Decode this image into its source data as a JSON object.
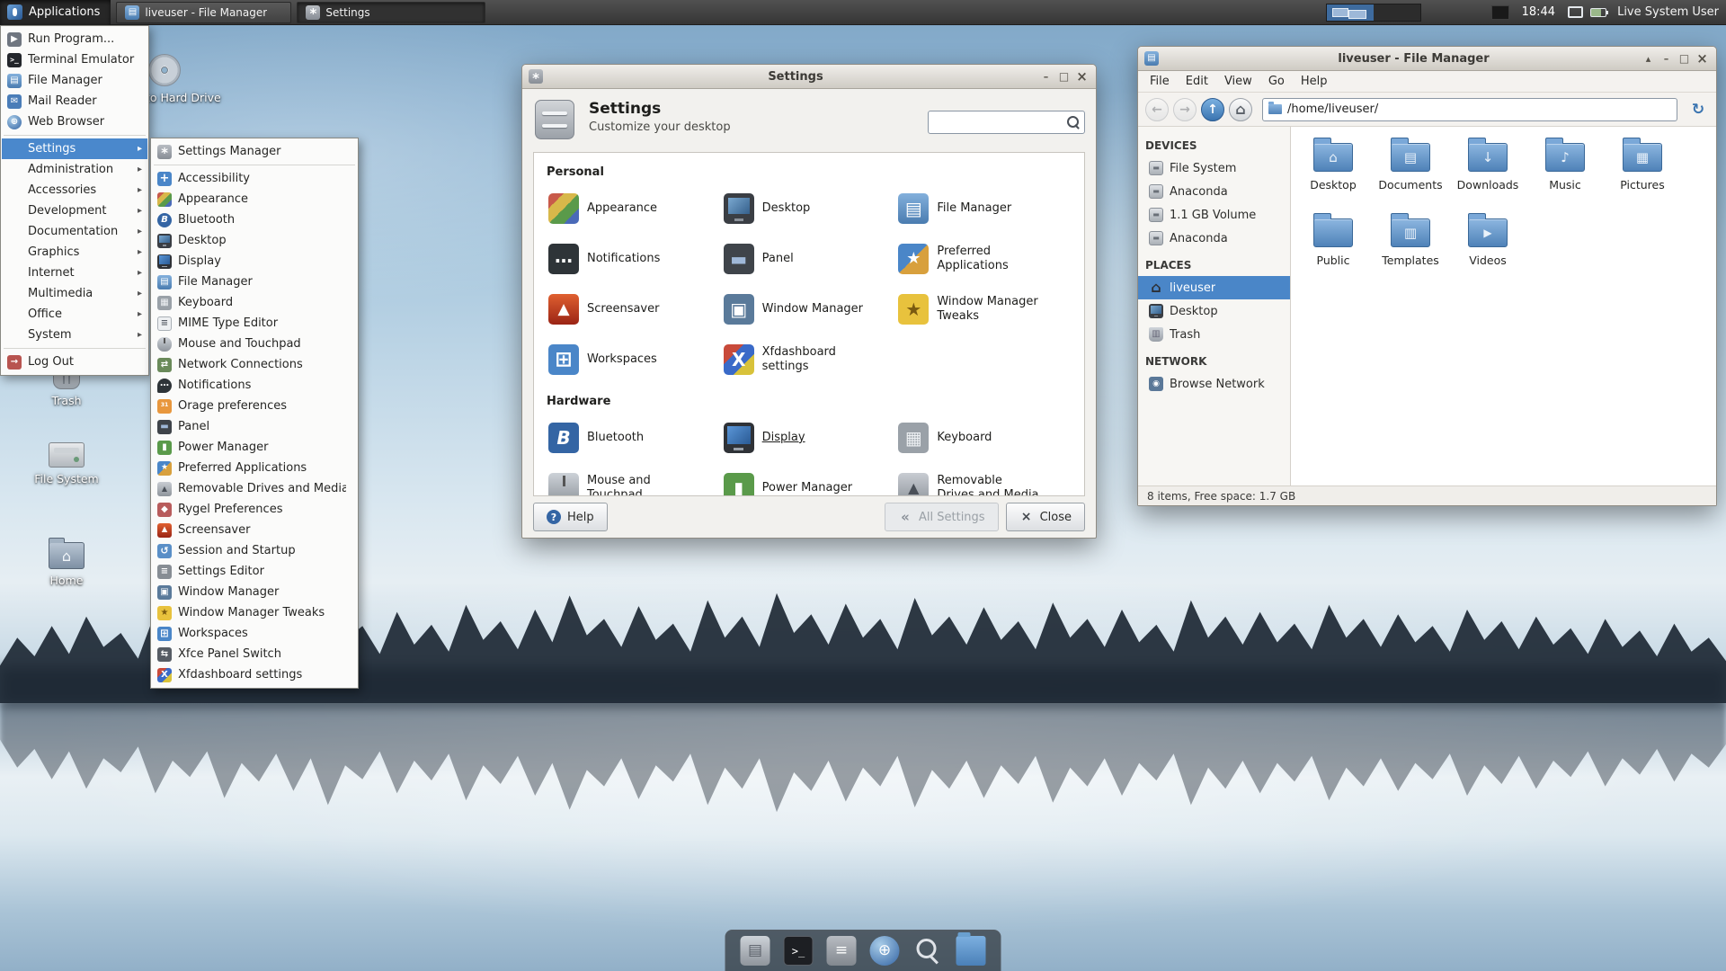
{
  "taskbar": {
    "applications": "Applications",
    "windows": [
      {
        "label": "liveuser - File Manager"
      },
      {
        "label": "Settings"
      }
    ],
    "clock": "18:44",
    "user": "Live System User"
  },
  "applications_menu": {
    "items": [
      {
        "label": "Run Program...",
        "icon": "ic-run"
      },
      {
        "label": "Terminal Emulator",
        "icon": "ic-terminal"
      },
      {
        "label": "File Manager",
        "icon": "ic-filemanager"
      },
      {
        "label": "Mail Reader",
        "icon": "ic-mail"
      },
      {
        "label": "Web Browser",
        "icon": "ic-browser"
      },
      {
        "cls": "separator"
      },
      {
        "label": "Settings",
        "cls": "highlighted",
        "arrow": "▸"
      },
      {
        "label": "Administration",
        "arrow": "▸"
      },
      {
        "label": "Accessories",
        "arrow": "▸"
      },
      {
        "label": "Development",
        "arrow": "▸"
      },
      {
        "label": "Documentation",
        "arrow": "▸"
      },
      {
        "label": "Graphics",
        "arrow": "▸"
      },
      {
        "label": "Internet",
        "arrow": "▸"
      },
      {
        "label": "Multimedia",
        "arrow": "▸"
      },
      {
        "label": "Office",
        "arrow": "▸"
      },
      {
        "label": "System",
        "arrow": "▸"
      },
      {
        "cls": "separator"
      },
      {
        "label": "Log Out",
        "icon": "ic-logout"
      }
    ]
  },
  "settings_submenu": {
    "items": [
      {
        "label": "Settings Manager",
        "icon": "ic-gear"
      },
      {
        "cls": "separator"
      },
      {
        "label": "Accessibility",
        "icon": "ic-access"
      },
      {
        "label": "Appearance",
        "icon": "ic-appearance"
      },
      {
        "label": "Bluetooth",
        "icon": "ic-bluetooth"
      },
      {
        "label": "Desktop",
        "icon": "ic-desktopmon"
      },
      {
        "label": "Display",
        "icon": "ic-display"
      },
      {
        "label": "File Manager",
        "icon": "ic-filemanager"
      },
      {
        "label": "Keyboard",
        "icon": "ic-keyboard"
      },
      {
        "label": "MIME Type Editor",
        "icon": "ic-mime"
      },
      {
        "label": "Mouse and Touchpad",
        "icon": "ic-mouse"
      },
      {
        "label": "Network Connections",
        "icon": "ic-network"
      },
      {
        "label": "Notifications",
        "icon": "ic-notify"
      },
      {
        "label": "Orage preferences",
        "icon": "ic-orage"
      },
      {
        "label": "Panel",
        "icon": "ic-panel"
      },
      {
        "label": "Power Manager",
        "icon": "ic-power"
      },
      {
        "label": "Preferred Applications",
        "icon": "ic-preferred"
      },
      {
        "label": "Removable Drives and Media",
        "icon": "ic-removable"
      },
      {
        "label": "Rygel Preferences",
        "icon": "ic-rygel"
      },
      {
        "label": "Screensaver",
        "icon": "ic-screensaver"
      },
      {
        "label": "Session and Startup",
        "icon": "ic-session"
      },
      {
        "label": "Settings Editor",
        "icon": "ic-editor"
      },
      {
        "label": "Window Manager",
        "icon": "ic-wm"
      },
      {
        "label": "Window Manager Tweaks",
        "icon": "ic-wmtweaks"
      },
      {
        "label": "Workspaces",
        "icon": "ic-workspaces"
      },
      {
        "label": "Xfce Panel Switch",
        "icon": "ic-panelswitch"
      },
      {
        "label": "Xfdashboard settings",
        "icon": "ic-xfdash"
      }
    ]
  },
  "settings_window": {
    "title": "Settings",
    "header_title": "Settings",
    "header_subtitle": "Customize your desktop",
    "search_value": "",
    "personal_title": "Personal",
    "personal_tiles": [
      {
        "label": "Appearance",
        "icon": "ic-appearance"
      },
      {
        "label": "Desktop",
        "icon": "ic-desktopmon"
      },
      {
        "label": "File Manager",
        "icon": "ic-filemanager"
      },
      {
        "label": "Notifications",
        "icon": "ic-notify"
      },
      {
        "label": "Panel",
        "icon": "ic-panel"
      },
      {
        "label": "Preferred Applications",
        "icon": "ic-preferred"
      },
      {
        "label": "Screensaver",
        "icon": "ic-screensaver"
      },
      {
        "label": "Window Manager",
        "icon": "ic-wm"
      },
      {
        "label": "Window Manager Tweaks",
        "icon": "ic-wmtweaks"
      },
      {
        "label": "Workspaces",
        "icon": "ic-workspaces"
      },
      {
        "label": "Xfdashboard settings",
        "icon": "ic-xfdash"
      }
    ],
    "hardware_title": "Hardware",
    "hardware_tiles": [
      {
        "label": "Bluetooth",
        "icon": "ic-bluetooth"
      },
      {
        "label": "Display",
        "icon": "ic-display",
        "cls": "focused"
      },
      {
        "label": "Keyboard",
        "icon": "ic-keyboard"
      },
      {
        "label": "Mouse and Touchpad",
        "icon": "ic-mouse"
      },
      {
        "label": "Power Manager",
        "icon": "ic-power"
      },
      {
        "label": "Removable Drives and Media",
        "icon": "ic-removable"
      }
    ],
    "buttons": {
      "help": "Help",
      "all_settings": "All Settings",
      "close": "Close"
    }
  },
  "file_manager": {
    "title": "liveuser - File Manager",
    "menu": [
      "File",
      "Edit",
      "View",
      "Go",
      "Help"
    ],
    "path": "/home/liveuser/",
    "devices_header": "DEVICES",
    "devices": [
      {
        "label": "File System",
        "icon": "ic-harddisk"
      },
      {
        "label": "Anaconda",
        "icon": "ic-harddisk"
      },
      {
        "label": "1.1 GB Volume",
        "icon": "ic-harddisk"
      },
      {
        "label": "Anaconda",
        "icon": "ic-harddisk"
      }
    ],
    "places_header": "PLACES",
    "places": [
      {
        "label": "liveuser",
        "icon": "ic-homedir",
        "cls": "selected"
      },
      {
        "label": "Desktop",
        "icon": "ic-desktopsm"
      },
      {
        "label": "Trash",
        "icon": "ic-trashsm"
      }
    ],
    "network_header": "NETWORK",
    "network": [
      {
        "label": "Browse Network",
        "icon": "ic-netsm"
      }
    ],
    "folders": [
      {
        "label": "Desktop",
        "emblem": "em-desktop"
      },
      {
        "label": "Documents",
        "emblem": "em-doc"
      },
      {
        "label": "Downloads",
        "emblem": "em-down"
      },
      {
        "label": "Music",
        "emblem": "em-music"
      },
      {
        "label": "Pictures",
        "emblem": "em-pic"
      },
      {
        "label": "Public"
      },
      {
        "label": "Templates",
        "emblem": "em-tmpl"
      },
      {
        "label": "Videos",
        "emblem": "em-video"
      }
    ],
    "status": "8 items, Free space: 1.7 GB"
  },
  "desktop_icons": [
    {
      "label": "Install to Hard Drive"
    },
    {
      "label": "Trash"
    },
    {
      "label": "File System"
    },
    {
      "label": "Home"
    }
  ],
  "dock": {
    "items": [
      {
        "icon": "dk-filemanager",
        "name": "file-manager"
      },
      {
        "icon": "dk-terminal",
        "name": "terminal"
      },
      {
        "icon": "dk-editor",
        "name": "text-editor"
      },
      {
        "icon": "dk-browser",
        "name": "web-browser"
      },
      {
        "icon": "dk-search",
        "name": "app-finder"
      },
      {
        "icon": "dk-folder",
        "name": "file-browser"
      }
    ]
  }
}
